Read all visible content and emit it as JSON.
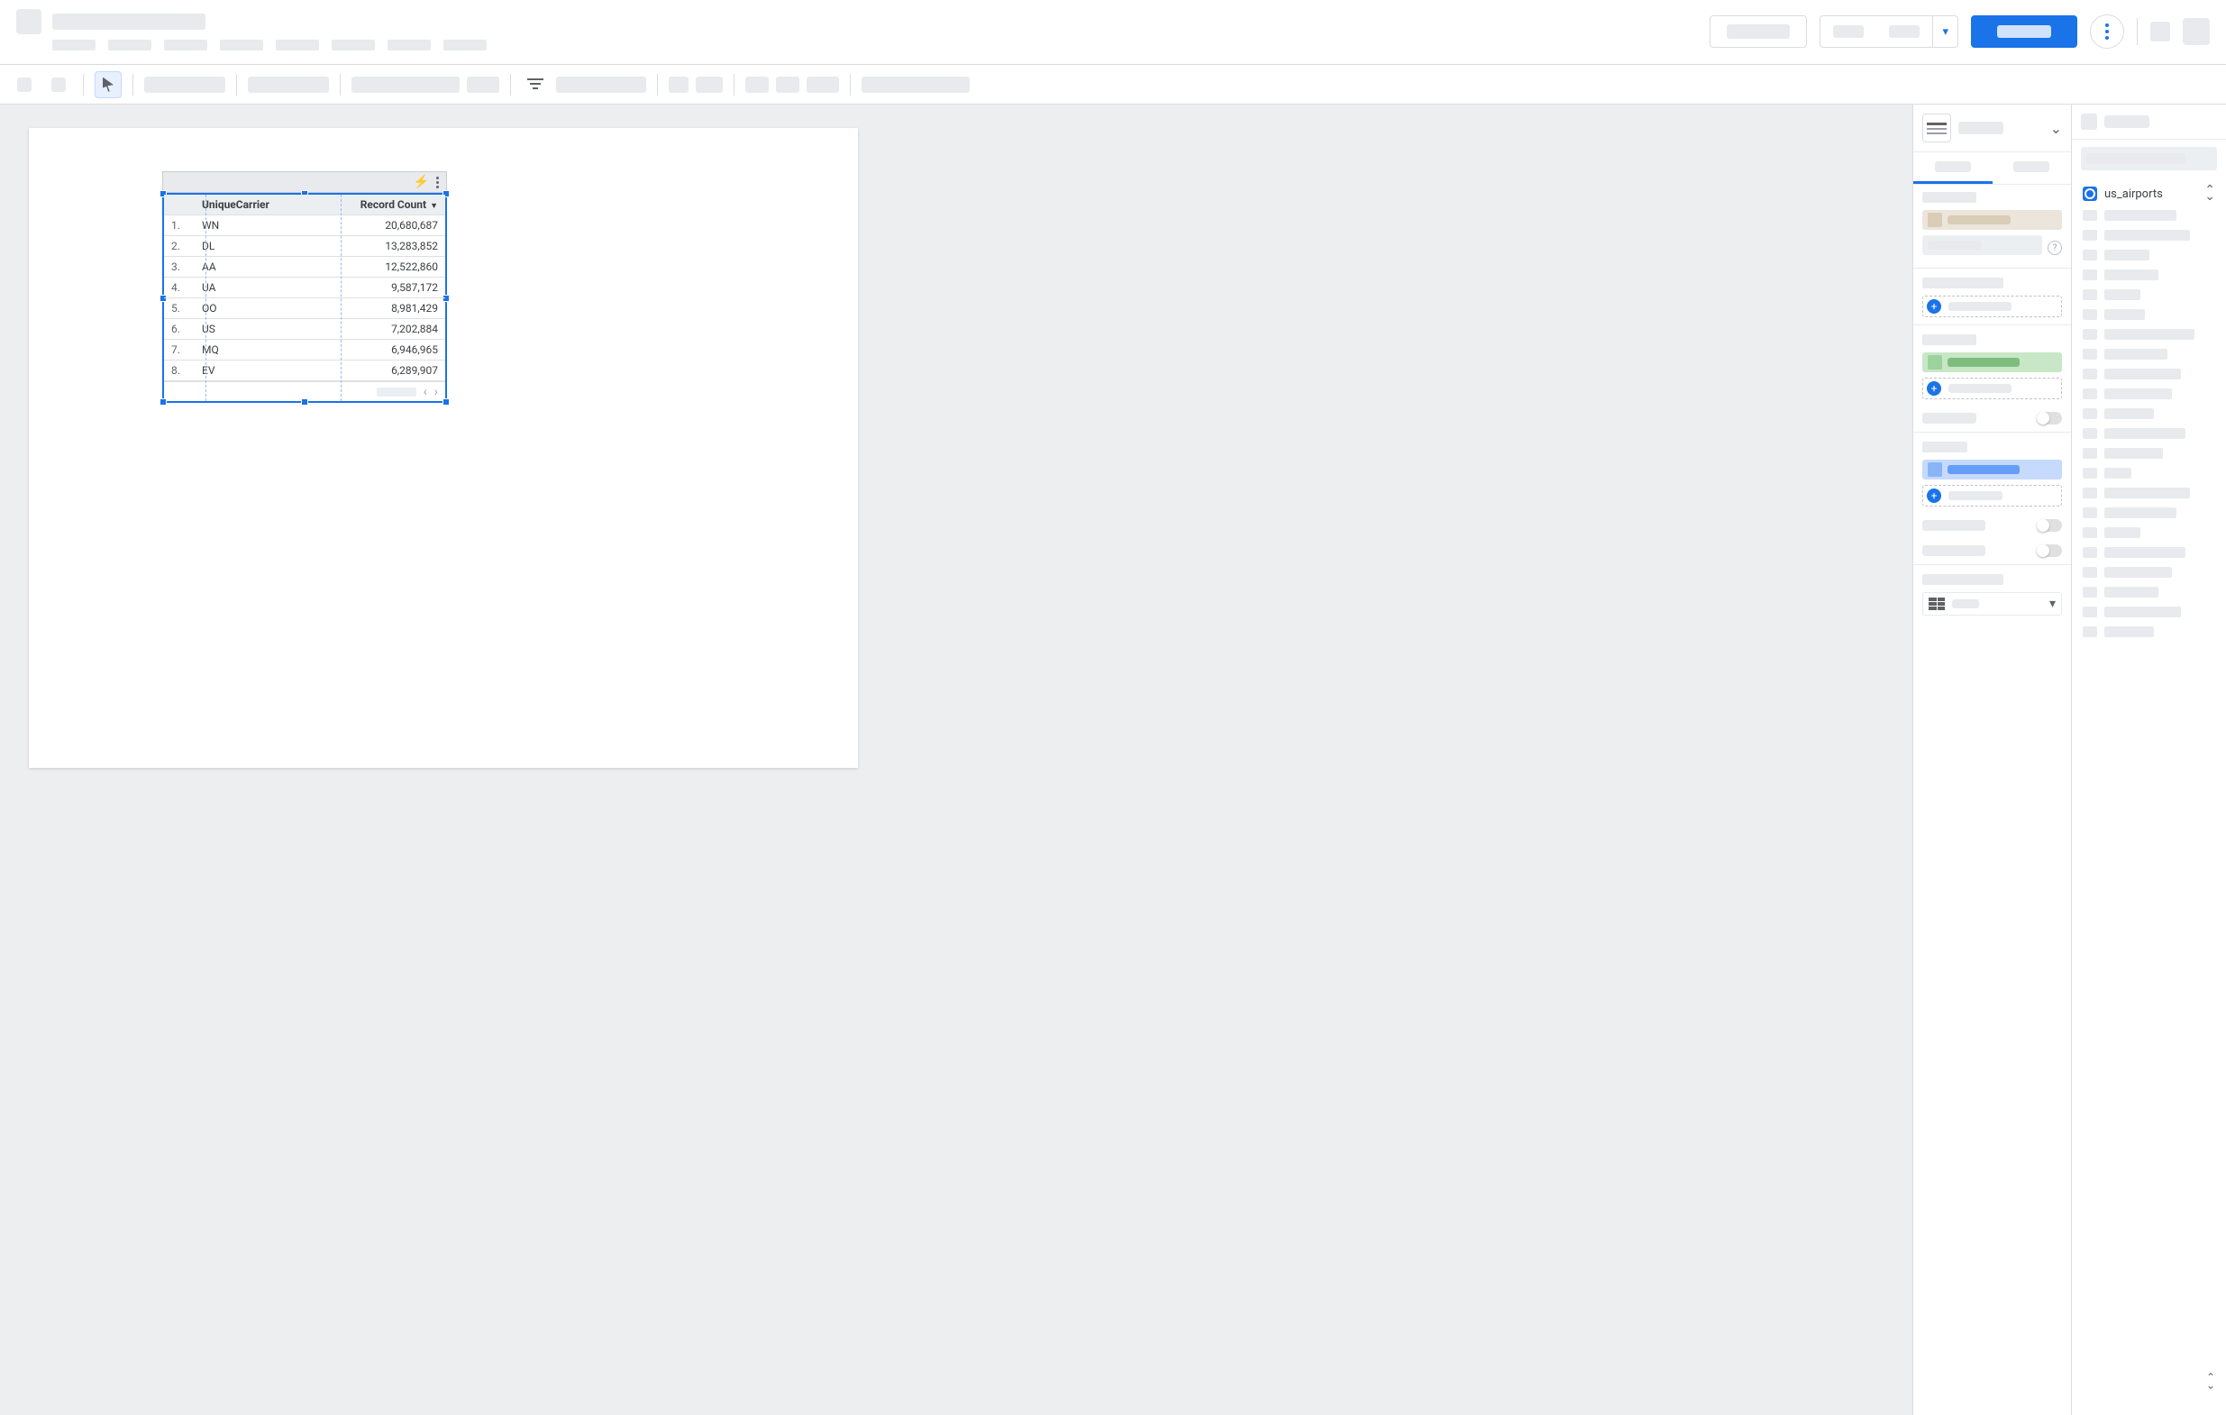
{
  "table": {
    "headers": {
      "col1": "UniqueCarrier",
      "col2": "Record Count"
    },
    "rows": [
      {
        "idx": "1.",
        "carrier": "WN",
        "count": "20,680,687"
      },
      {
        "idx": "2.",
        "carrier": "DL",
        "count": "13,283,852"
      },
      {
        "idx": "3.",
        "carrier": "AA",
        "count": "12,522,860"
      },
      {
        "idx": "4.",
        "carrier": "UA",
        "count": "9,587,172"
      },
      {
        "idx": "5.",
        "carrier": "OO",
        "count": "8,981,429"
      },
      {
        "idx": "6.",
        "carrier": "US",
        "count": "7,202,884"
      },
      {
        "idx": "7.",
        "carrier": "MQ",
        "count": "6,946,965"
      },
      {
        "idx": "8.",
        "carrier": "EV",
        "count": "6,289,907"
      }
    ]
  },
  "data_panel": {
    "source_name": "us_airports"
  },
  "chart_data": {
    "type": "table",
    "columns": [
      "UniqueCarrier",
      "Record Count"
    ],
    "sort": {
      "column": "Record Count",
      "direction": "desc"
    },
    "rows": [
      [
        "WN",
        20680687
      ],
      [
        "DL",
        13283852
      ],
      [
        "AA",
        12522860
      ],
      [
        "UA",
        9587172
      ],
      [
        "OO",
        8981429
      ],
      [
        "US",
        7202884
      ],
      [
        "MQ",
        6946965
      ],
      [
        "EV",
        6289907
      ]
    ]
  }
}
